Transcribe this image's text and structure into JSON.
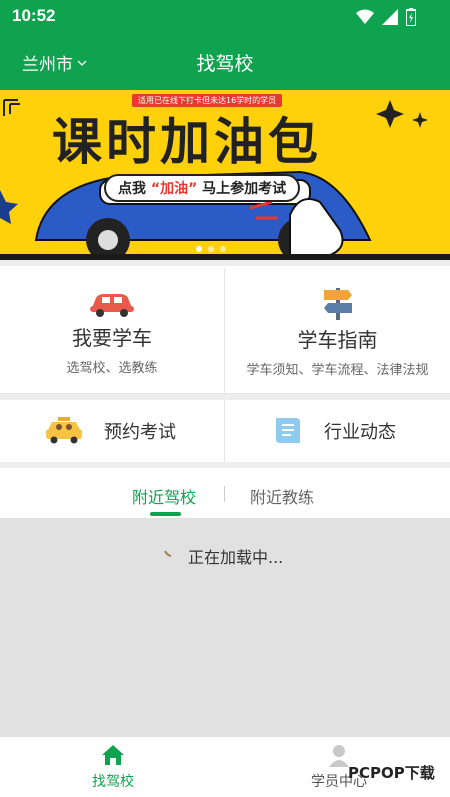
{
  "status_bar": {
    "time": "10:52"
  },
  "header": {
    "city": "兰州市",
    "title": "找驾校"
  },
  "banner": {
    "tagline": "适用已在线下打卡但未达16学时的学员",
    "headline": "课时加油包",
    "cta_parts": [
      "点我",
      "“加油”",
      "马上参加考试"
    ]
  },
  "features": {
    "learn": {
      "title": "我要学车",
      "subtitle": "选驾校、选教练"
    },
    "guide": {
      "title": "学车指南",
      "subtitle": "学车须知、学车流程、法律法规"
    },
    "exam": {
      "title": "预约考试"
    },
    "news": {
      "title": "行业动态"
    }
  },
  "tabs": [
    {
      "label": "附近驾校",
      "active": true
    },
    {
      "label": "附近教练",
      "active": false
    }
  ],
  "content": {
    "loading_text": "正在加载中..."
  },
  "bottom_nav": [
    {
      "label": "找驾校",
      "active": true
    },
    {
      "label": "学员中心",
      "active": false
    }
  ],
  "watermark": "PCPOP下载",
  "colors": {
    "primary": "#0fa24f",
    "banner": "#ffd10a",
    "accent_red": "#e53a2f"
  }
}
